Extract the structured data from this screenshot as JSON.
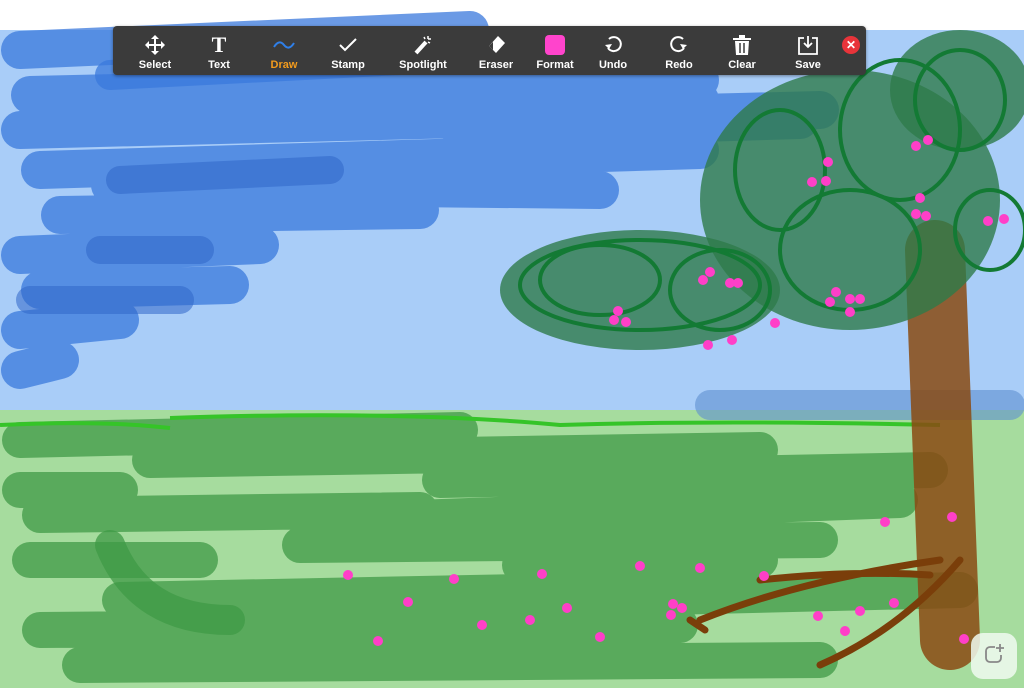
{
  "toolbar": {
    "tools": [
      {
        "label": "Select",
        "icon": "move-icon"
      },
      {
        "label": "Text",
        "icon": "text-icon"
      },
      {
        "label": "Draw",
        "icon": "squiggle-icon",
        "active": true
      },
      {
        "label": "Stamp",
        "icon": "checkmark-icon"
      },
      {
        "label": "Spotlight",
        "icon": "magic-wand-icon"
      },
      {
        "label": "Eraser",
        "icon": "eraser-icon"
      },
      {
        "label": "Format",
        "icon": "color-swatch-icon"
      },
      {
        "label": "Undo",
        "icon": "undo-icon"
      },
      {
        "label": "Redo",
        "icon": "redo-icon"
      },
      {
        "label": "Clear",
        "icon": "trash-icon"
      },
      {
        "label": "Save",
        "icon": "save-icon"
      }
    ],
    "close_icon": "close-icon",
    "format_color": "#ff44cc",
    "active_color": "#f29b1d",
    "draw_icon_color": "#2f7fe8"
  },
  "fab": {
    "icon": "new-whiteboard-icon"
  }
}
